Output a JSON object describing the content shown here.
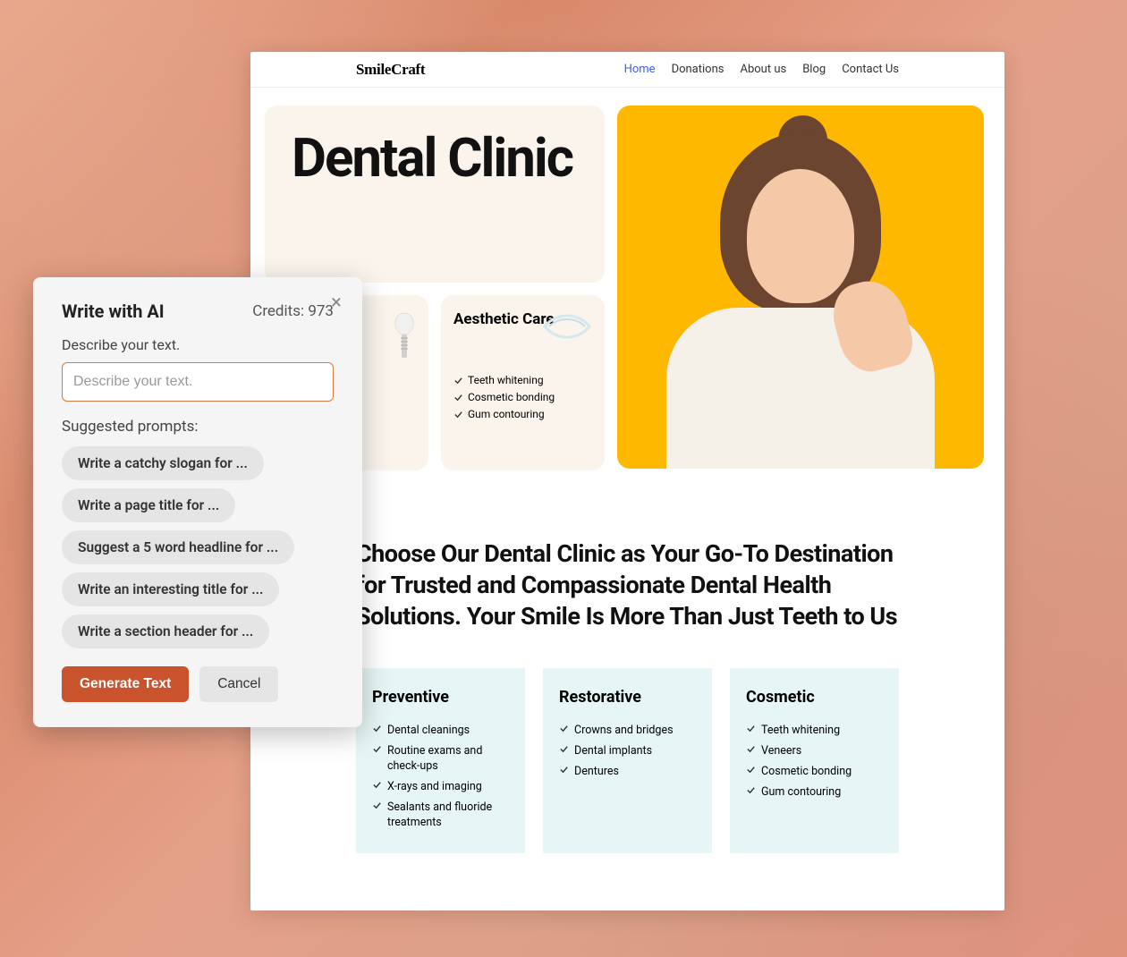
{
  "site": {
    "logo": "SmileCraft",
    "nav": [
      "Home",
      "Donations",
      "About us",
      "Blog",
      "Contact Us"
    ],
    "nav_active_index": 0,
    "hero_title": "Dental Clinic",
    "aesthetic_card": {
      "title": "Aesthetic Care",
      "items": [
        "Teeth whitening",
        "Cosmetic bonding",
        "Gum contouring"
      ]
    },
    "section_heading": "Choose Our Dental Clinic as Your Go-To Destination for Trusted and Compassionate Dental Health Solutions. Your Smile Is More Than Just Teeth to Us",
    "grid": [
      {
        "title": "Preventive",
        "items": [
          "Dental cleanings",
          "Routine exams and check-ups",
          "X-rays and imaging",
          "Sealants and fluoride treatments"
        ]
      },
      {
        "title": "Restorative",
        "items": [
          "Crowns and bridges",
          "Dental implants",
          "Dentures"
        ]
      },
      {
        "title": "Cosmetic",
        "items": [
          "Teeth whitening",
          "Veneers",
          "Cosmetic bonding",
          "Gum contouring"
        ]
      }
    ]
  },
  "ai": {
    "title": "Write with AI",
    "credits_label": "Credits: 973",
    "describe_label": "Describe your text.",
    "input_placeholder": "Describe your text.",
    "suggested_label": "Suggested prompts:",
    "chips": [
      "Write a catchy slogan for ...",
      "Write a page title for ...",
      "Suggest a 5 word headline for ...",
      "Write an interesting title for ...",
      "Write a section header for ..."
    ],
    "generate": "Generate Text",
    "cancel": "Cancel"
  }
}
